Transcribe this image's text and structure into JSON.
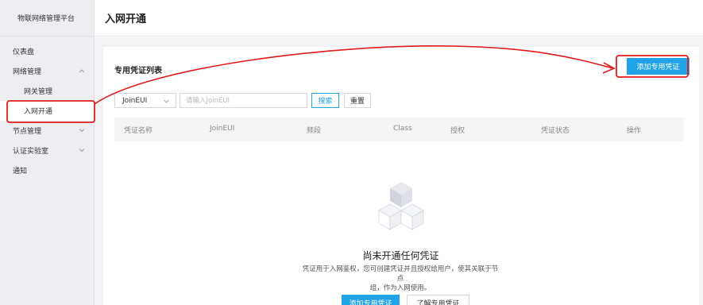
{
  "sidebar": {
    "brand": "物联网络管理平台",
    "items": [
      {
        "label": "仪表盘"
      },
      {
        "label": "网络管理"
      },
      {
        "label": "网关管理"
      },
      {
        "label": "入网开通"
      },
      {
        "label": "节点管理"
      },
      {
        "label": "认证实验室"
      },
      {
        "label": "通知"
      }
    ]
  },
  "header": {
    "title": "入网开通"
  },
  "card": {
    "title": "专用凭证列表",
    "add_button": "添加专用凭证"
  },
  "filter": {
    "select_value": "JoinEUI",
    "search_placeholder": "请输入JoinEUI",
    "search_button": "搜索",
    "reset_button": "重置"
  },
  "table": {
    "columns": [
      "凭证名称",
      "JoinEUI",
      "频段",
      "Class",
      "授权",
      "凭证状态",
      "操作"
    ]
  },
  "empty": {
    "title": "尚未开通任何凭证",
    "desc_line1": "凭证用于入网鉴权，您可创建凭证并且授权给用户，使其关联于节点",
    "desc_line2": "组，作为入网使用。",
    "add_button": "添加专用凭证",
    "learn_button": "了解专用凭证"
  },
  "colors": {
    "primary": "#20a3e7",
    "annotation": "#e11b1b"
  }
}
